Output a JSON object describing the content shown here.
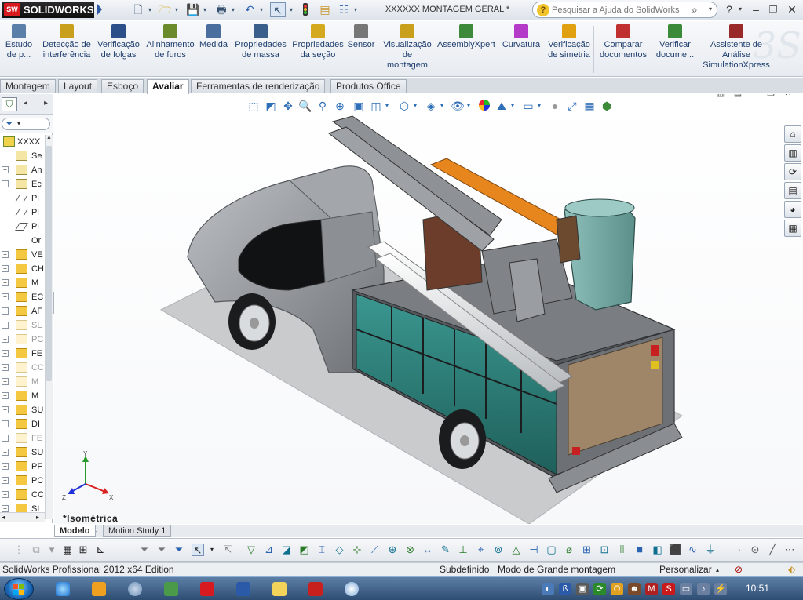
{
  "app": {
    "brand": "SOLIDWORKS",
    "brand_badge": "SW",
    "document_title": "XXXXXX MONTAGEM GERAL *",
    "help_search_placeholder": "Pesquisar a Ajuda do SolidWorks"
  },
  "commands": [
    {
      "id": "estudo",
      "label": "Estudo\nde p...",
      "icon": "study-icon",
      "color": "#5a7fa8"
    },
    {
      "id": "deteccao",
      "label": "Detecção de\ninterferência",
      "icon": "interference-icon",
      "color": "#c8a01c"
    },
    {
      "id": "folgas",
      "label": "Verificação\nde folgas",
      "icon": "clearance-icon",
      "color": "#2c4f8a"
    },
    {
      "id": "furos",
      "label": "Alinhamento\nde furos",
      "icon": "hole-alignment-icon",
      "color": "#6b8a2a"
    },
    {
      "id": "medida",
      "label": "Medida",
      "icon": "measure-icon",
      "color": "#4a6f9e"
    },
    {
      "id": "massa",
      "label": "Propriedades\nde massa",
      "icon": "mass-properties-icon",
      "color": "#3a5f8a"
    },
    {
      "id": "secao",
      "label": "Propriedades\nda seção",
      "icon": "section-properties-icon",
      "color": "#d4a91e"
    },
    {
      "id": "sensor",
      "label": "Sensor",
      "icon": "sensor-icon",
      "color": "#777777"
    },
    {
      "id": "visualizacao",
      "label": "Visualização\nde\nmontagem",
      "icon": "assembly-visualization-icon",
      "color": "#c8a01c"
    },
    {
      "id": "assemblyxpert",
      "label": "AssemblyXpert",
      "icon": "assemblyxpert-icon",
      "color": "#3c8a3a"
    },
    {
      "id": "curvatura",
      "label": "Curvatura",
      "icon": "curvature-icon",
      "color": "#b43ac8"
    },
    {
      "id": "simetria",
      "label": "Verificação\nde simetria",
      "icon": "symmetry-icon",
      "color": "#e0a010"
    },
    {
      "id": "comparar",
      "label": "Comparar\ndocumentos",
      "icon": "compare-documents-icon",
      "color": "#c03030"
    },
    {
      "id": "verificar",
      "label": "Verificar\ndocume...",
      "icon": "check-document-icon",
      "color": "#3a8a3a"
    },
    {
      "id": "simxpress",
      "label": "Assistente de\nAnálise\nSimulationXpress",
      "icon": "simulationxpress-icon",
      "color": "#9a2a2a"
    }
  ],
  "tabs": [
    "Montagem",
    "Layout",
    "Esboço",
    "Avaliar",
    "Ferramentas de renderização",
    "Produtos Office"
  ],
  "active_tab": "Avaliar",
  "feature_tree": [
    {
      "label": "XXXX",
      "icon": "assembly-icon",
      "expander": "",
      "dim": false
    },
    {
      "label": "Se",
      "icon": "sensors-icon",
      "expander": "",
      "dim": false
    },
    {
      "label": "An",
      "icon": "annotations-icon",
      "expander": "+",
      "dim": false
    },
    {
      "label": "Ec",
      "icon": "equations-icon",
      "expander": "+",
      "dim": false
    },
    {
      "label": "Pl",
      "icon": "plane-icon",
      "expander": "",
      "dim": false
    },
    {
      "label": "Pl",
      "icon": "plane-icon",
      "expander": "",
      "dim": false
    },
    {
      "label": "Pl",
      "icon": "plane-icon",
      "expander": "",
      "dim": false
    },
    {
      "label": "Or",
      "icon": "origin-icon",
      "expander": "",
      "dim": false
    },
    {
      "label": "VE",
      "icon": "folder-icon",
      "expander": "+",
      "dim": false
    },
    {
      "label": "CH",
      "icon": "folder-icon",
      "expander": "+",
      "dim": false
    },
    {
      "label": "M",
      "icon": "folder-icon",
      "expander": "+",
      "dim": false
    },
    {
      "label": "EC",
      "icon": "folder-icon",
      "expander": "+",
      "dim": false
    },
    {
      "label": "AF",
      "icon": "folder-icon",
      "expander": "+",
      "dim": false
    },
    {
      "label": "SL",
      "icon": "folder-icon",
      "expander": "+",
      "dim": true
    },
    {
      "label": "PC",
      "icon": "folder-icon",
      "expander": "+",
      "dim": true
    },
    {
      "label": "FE",
      "icon": "folder-icon",
      "expander": "+",
      "dim": false
    },
    {
      "label": "CC",
      "icon": "folder-icon",
      "expander": "+",
      "dim": true
    },
    {
      "label": "M",
      "icon": "folder-icon",
      "expander": "+",
      "dim": true
    },
    {
      "label": "M",
      "icon": "folder-icon",
      "expander": "+",
      "dim": false
    },
    {
      "label": "SU",
      "icon": "folder-icon",
      "expander": "+",
      "dim": false
    },
    {
      "label": "DI",
      "icon": "folder-icon",
      "expander": "+",
      "dim": false
    },
    {
      "label": "FE",
      "icon": "folder-icon",
      "expander": "+",
      "dim": true
    },
    {
      "label": "SU",
      "icon": "folder-icon",
      "expander": "+",
      "dim": false
    },
    {
      "label": "PF",
      "icon": "folder-icon",
      "expander": "+",
      "dim": false
    },
    {
      "label": "PC",
      "icon": "folder-icon",
      "expander": "+",
      "dim": false
    },
    {
      "label": "CC",
      "icon": "folder-icon",
      "expander": "+",
      "dim": false
    },
    {
      "label": "SL",
      "icon": "folder-icon",
      "expander": "+",
      "dim": false
    }
  ],
  "viewport": {
    "view_name": "*Isométrica",
    "triad_axes": [
      "Y",
      "Z",
      "X"
    ]
  },
  "bottom_tabs": [
    "Modelo",
    "Motion Study 1"
  ],
  "active_bottom_tab": "Modelo",
  "status": {
    "edition": "SolidWorks Profissional 2012 x64 Edition",
    "state": "Subdefinido",
    "mode": "Modo de Grande montagem",
    "customize": "Personalizar"
  },
  "taskbar": {
    "clock": "10:51",
    "pinned": [
      "internet-explorer-icon",
      "outlook-icon",
      "network-icon",
      "app-icon",
      "solidworks-icon",
      "word-icon",
      "explorer-icon",
      "acrobat-icon",
      "paint-icon"
    ]
  },
  "colors": {
    "accent_blue": "#2f6fb7",
    "truck_gray": "#9a9ea3",
    "boom_orange": "#e8861e",
    "panel_teal": "#2f7f7a",
    "bucket_teal": "#7fb3ae"
  }
}
